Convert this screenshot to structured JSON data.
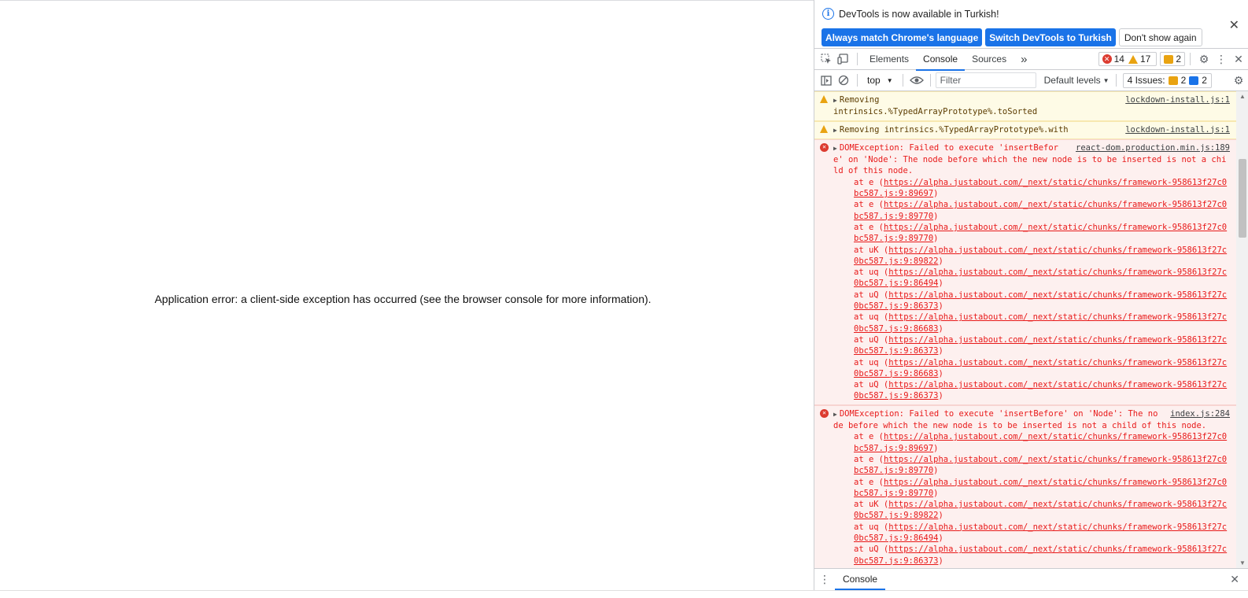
{
  "page": {
    "error_message": "Application error: a client-side exception has occurred (see the browser console for more information)."
  },
  "infobar": {
    "message": "DevTools is now available in Turkish!",
    "btn_match": "Always match Chrome's language",
    "btn_switch": "Switch DevTools to Turkish",
    "btn_dismiss": "Don't show again"
  },
  "tabs": {
    "elements": "Elements",
    "console": "Console",
    "sources": "Sources",
    "more": "»"
  },
  "counts": {
    "errors": "14",
    "warnings": "17",
    "info": "2"
  },
  "toolbar": {
    "context": "top",
    "filter_placeholder": "Filter",
    "levels": "Default levels",
    "issues_label": "4 Issues:",
    "issues_warn": "2",
    "issues_info": "2"
  },
  "messages": {
    "w1": {
      "text": "Removing\nintrinsics.%TypedArrayPrototype%.toSorted",
      "source": "lockdown-install.js:1"
    },
    "w2": {
      "text": "Removing intrinsics.%TypedArrayPrototype%.with",
      "source": "lockdown-install.js:1"
    },
    "e1": {
      "text": "DOMException: Failed to execute 'insertBefore' on 'Node': The node before which the new node is to be inserted is not a child of this node.",
      "source": "react-dom.production.min.js:189",
      "frames": [
        {
          "fn": "at e (",
          "url": "https://alpha.justabout.com/_next/static/chunks/framework-958613f27c0bc587.js:9:89697",
          "end": ")"
        },
        {
          "fn": "at e (",
          "url": "https://alpha.justabout.com/_next/static/chunks/framework-958613f27c0bc587.js:9:89770",
          "end": ")"
        },
        {
          "fn": "at e (",
          "url": "https://alpha.justabout.com/_next/static/chunks/framework-958613f27c0bc587.js:9:89770",
          "end": ")"
        },
        {
          "fn": "at uK (",
          "url": "https://alpha.justabout.com/_next/static/chunks/framework-958613f27c0bc587.js:9:89822",
          "end": ")"
        },
        {
          "fn": "at uq (",
          "url": "https://alpha.justabout.com/_next/static/chunks/framework-958613f27c0bc587.js:9:86494",
          "end": ")"
        },
        {
          "fn": "at uQ (",
          "url": "https://alpha.justabout.com/_next/static/chunks/framework-958613f27c0bc587.js:9:86373",
          "end": ")"
        },
        {
          "fn": "at uq (",
          "url": "https://alpha.justabout.com/_next/static/chunks/framework-958613f27c0bc587.js:9:86683",
          "end": ")"
        },
        {
          "fn": "at uQ (",
          "url": "https://alpha.justabout.com/_next/static/chunks/framework-958613f27c0bc587.js:9:86373",
          "end": ")"
        },
        {
          "fn": "at uq (",
          "url": "https://alpha.justabout.com/_next/static/chunks/framework-958613f27c0bc587.js:9:86683",
          "end": ")"
        },
        {
          "fn": "at uQ (",
          "url": "https://alpha.justabout.com/_next/static/chunks/framework-958613f27c0bc587.js:9:86373",
          "end": ")"
        }
      ]
    },
    "e2": {
      "text": "DOMException: Failed to execute 'insertBefore' on 'Node': The node before which the new node is to be inserted is not a child of this node.",
      "source": "index.js:284",
      "frames": [
        {
          "fn": "at e (",
          "url": "https://alpha.justabout.com/_next/static/chunks/framework-958613f27c0bc587.js:9:89697",
          "end": ")"
        },
        {
          "fn": "at e (",
          "url": "https://alpha.justabout.com/_next/static/chunks/framework-958613f27c0bc587.js:9:89770",
          "end": ")"
        },
        {
          "fn": "at e (",
          "url": "https://alpha.justabout.com/_next/static/chunks/framework-958613f27c0bc587.js:9:89770",
          "end": ")"
        },
        {
          "fn": "at uK (",
          "url": "https://alpha.justabout.com/_next/static/chunks/framework-958613f27c0bc587.js:9:89822",
          "end": ")"
        },
        {
          "fn": "at uq (",
          "url": "https://alpha.justabout.com/_next/static/chunks/framework-958613f27c0bc587.js:9:86494",
          "end": ")"
        },
        {
          "fn": "at uQ (",
          "url": "https://alpha.justabout.com/_next/static/chunks/framework-958613f27c0bc587.js:9:86373",
          "end": ")"
        }
      ]
    }
  },
  "drawer": {
    "tab": "Console"
  },
  "icons": {
    "inspect": "inspect-element-icon",
    "device": "device-toolbar-icon",
    "settings": "gear-icon",
    "more": "vertical-dots-icon",
    "close": "close-icon"
  },
  "colors": {
    "accent": "#1a73e8",
    "error": "#e81a1a",
    "warning": "#e9a311"
  }
}
